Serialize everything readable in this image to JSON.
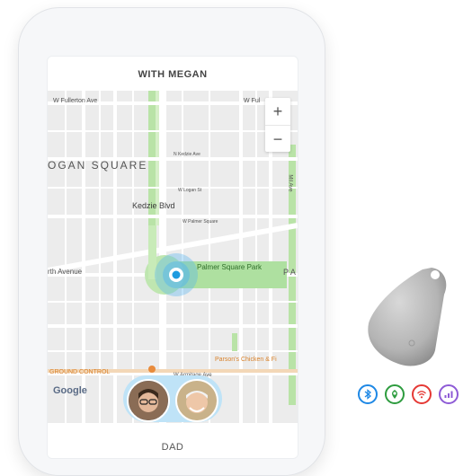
{
  "header": {
    "title": "WITH MEGAN"
  },
  "map": {
    "labels": {
      "fullerton_left": "W Fullerton Ave",
      "fullerton_right": "W Ful",
      "logan_square": "OGAN SQUARE",
      "kedzie": "Kedzie Blvd",
      "palmer": "Palmer Square Park",
      "palmer_letters": "P A",
      "north_avenue": "rth Avenue",
      "ground_control": "GROUND CONTROL",
      "parsons": "Parson's Chicken & Fi",
      "armitage": "W Armitage Ave",
      "small_1": "N Kedzie Ave",
      "small_2": "W Logan St",
      "small_3": "W Palmer Square",
      "small_4": "Mil Ave"
    },
    "zoom_in": "+",
    "zoom_out": "−",
    "attribution": "Google"
  },
  "footer": {
    "person_label": "DAD"
  },
  "feature_icons": [
    {
      "name": "bluetooth-icon",
      "color": "#1e88e5"
    },
    {
      "name": "location-pin-icon",
      "color": "#2e9c3f"
    },
    {
      "name": "wifi-icon",
      "color": "#e53935"
    },
    {
      "name": "signal-icon",
      "color": "#8e5bd6"
    }
  ]
}
